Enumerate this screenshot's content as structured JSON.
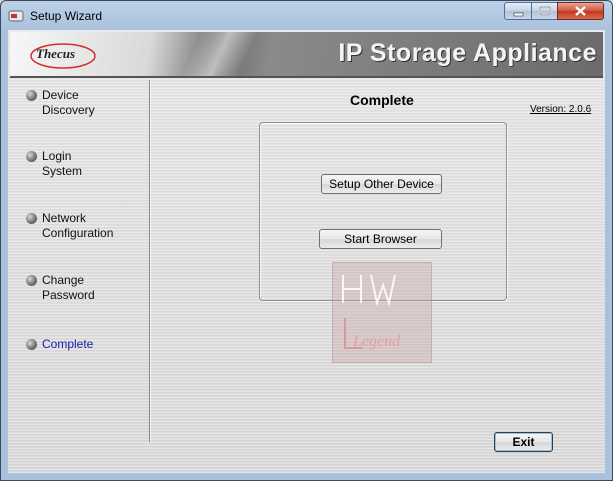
{
  "window": {
    "title": "Setup Wizard"
  },
  "banner": {
    "logo_text": "Thecus",
    "product_title": "IP Storage Appliance"
  },
  "steps": [
    {
      "label": "Device\nDiscovery",
      "active": false
    },
    {
      "label": "Login\nSystem",
      "active": false
    },
    {
      "label": "Network\nConfiguration",
      "active": false
    },
    {
      "label": "Change\nPassword",
      "active": false
    },
    {
      "label": "Complete",
      "active": true
    }
  ],
  "main": {
    "heading": "Complete",
    "version": "Version: 2.0.6",
    "setup_other_label": "Setup Other Device",
    "start_browser_label": "Start Browser"
  },
  "footer": {
    "exit_label": "Exit"
  },
  "watermark": {
    "top_text": "HW",
    "bottom_text": "Legend"
  },
  "colors": {
    "active_step": "#1a1aa8",
    "close_button": "#c0381e"
  }
}
